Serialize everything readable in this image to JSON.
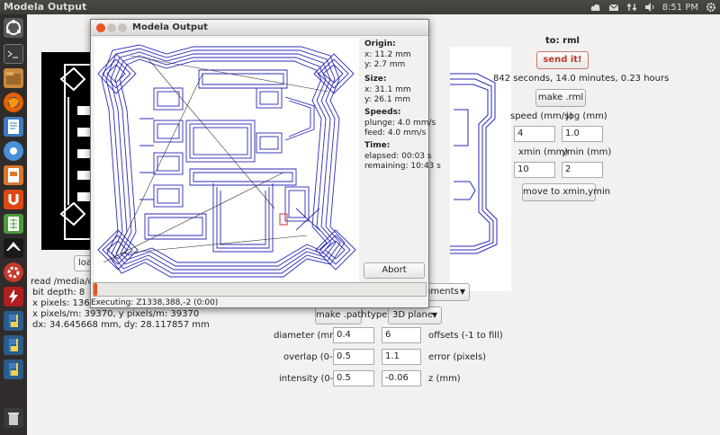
{
  "topbar": {
    "title": "Modela Output",
    "clock": "8:51 PM"
  },
  "launcher": {
    "items": [
      "ubuntu-dash",
      "terminal",
      "files",
      "firefox",
      "writer",
      "chromium",
      "impress",
      "ubuntu-one",
      "calc",
      "inkscape",
      "settings",
      "flash",
      "python",
      "python",
      "python",
      "trash"
    ]
  },
  "modela": {
    "title": "Modela Output",
    "origin_label": "Origin:",
    "origin_x": "x: 11.2 mm",
    "origin_y": "y: 2.7 mm",
    "size_label": "Size:",
    "size_x": "x: 31.1 mm",
    "size_y": "y: 26.1 mm",
    "speeds_label": "Speeds:",
    "plunge": "plunge: 4.0 mm/s",
    "feed": "feed: 4.0 mm/s",
    "time_label": "Time:",
    "elapsed": "elapsed: 00:03 s",
    "remaining": "remaining: 10:43 s",
    "abort": "Abort",
    "progress": 0.01,
    "status": "Executing: Z1338,388,-2 (0:00)"
  },
  "main": {
    "load_label": "loa",
    "to_label": "to: rml",
    "send_label": "send it!",
    "time_info": "842 seconds, 14.0 minutes, 0.23 hours",
    "make_rml": "make .rml",
    "speed_label": "speed (mm/s)",
    "jog_label": "jog (mm)",
    "speed_value": "4",
    "jog_value": "1.0",
    "xmin_label": "xmin (mm)",
    "ymin_label": "ymin (mm)",
    "xmin_value": "10",
    "ymin_value": "2",
    "move_label": "move to xmin,ymin",
    "read_info": "read /media/diyla",
    "bit_depth": "bit depth: 8",
    "x_pixels": "x pixels: 1364, y",
    "x_pixels_m": "x pixels/m: 39370, y pixels/m: 39370",
    "dx_dy": "dx: 34.645668 mm, dy: 28.117857 mm",
    "segments_label": "gments",
    "make_path": "make .path",
    "type_label": "type:",
    "type_value": "3D plane",
    "diameter_label": "diameter (mm)",
    "diameter_value": "0.4",
    "offsets_value": "6",
    "offsets_label": "offsets (-1 to fill)",
    "overlap_label": "overlap (0-1)",
    "overlap_value": "0.5",
    "error_value": "1.1",
    "error_label": "error (pixels)",
    "intensity_label": "intensity (0-1)",
    "intensity_value": "0.5",
    "z_value": "-0.06",
    "z_label": "z (mm)"
  },
  "colors": {
    "toolpath": "#2a2ab8",
    "accent": "#e95420",
    "send": "#c0392b"
  }
}
